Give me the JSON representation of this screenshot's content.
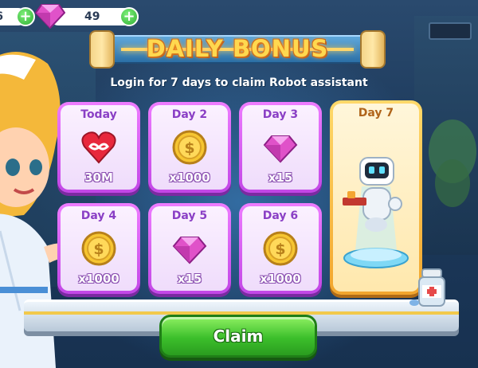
{
  "resources": {
    "left_value": "6",
    "gems_value": "49",
    "plus_symbol": "+"
  },
  "banner": {
    "title": "DAILY BONUS",
    "subtitle": "Login for 7 days to claim Robot assistant"
  },
  "rewards": [
    {
      "label": "Today",
      "icon": "infinite-heart-icon",
      "amount": "30M"
    },
    {
      "label": "Day 2",
      "icon": "gold-coin-icon",
      "amount": "x1000"
    },
    {
      "label": "Day 3",
      "icon": "pink-gem-icon",
      "amount": "x15"
    },
    {
      "label": "Day 4",
      "icon": "gold-coin-icon",
      "amount": "x1000"
    },
    {
      "label": "Day 5",
      "icon": "pink-gem-icon",
      "amount": "x15"
    },
    {
      "label": "Day 6",
      "icon": "gold-coin-icon",
      "amount": "x1000"
    },
    {
      "label": "Day 7",
      "icon": "robot-assistant-icon",
      "amount": ""
    }
  ],
  "claim": {
    "label": "Claim"
  },
  "colors": {
    "card_purple": "#c246e6",
    "card_gold": "#f2a52d",
    "claim_green": "#3cbf2b",
    "title_yellow": "#ffd84f"
  }
}
